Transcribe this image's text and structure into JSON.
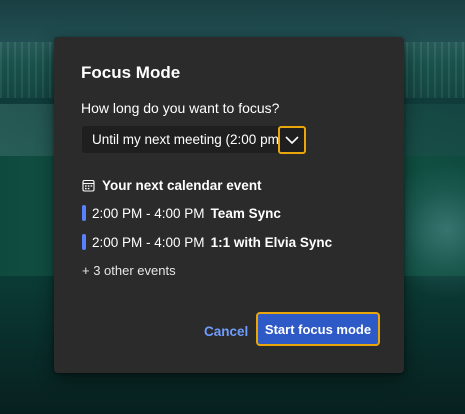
{
  "dialog": {
    "title": "Focus Mode",
    "question": "How long do you want to focus?",
    "duration_dropdown": {
      "selected": "Until my next meeting (2:00 pm)"
    },
    "calendar": {
      "heading": "Your next calendar event",
      "events": [
        {
          "time": "2:00 PM - 4:00 PM",
          "title": "Team Sync"
        },
        {
          "time": "2:00 PM - 4:00 PM",
          "title": "1:1 with Elvia Sync"
        }
      ],
      "more": "+ 3 other events"
    },
    "cancel_label": "Cancel",
    "start_label": "Start focus mode"
  },
  "colors": {
    "dialog_bg": "#2b2b2b",
    "dropdown_bg": "#1f1f1f",
    "accent_blue": "#2e5ac8",
    "link_blue": "#6f9dff",
    "event_bar": "#5b80ff",
    "focus_outline": "#e8a60a"
  },
  "icons": {
    "dropdown": "chevron-down-icon",
    "calendar": "calendar-icon"
  }
}
